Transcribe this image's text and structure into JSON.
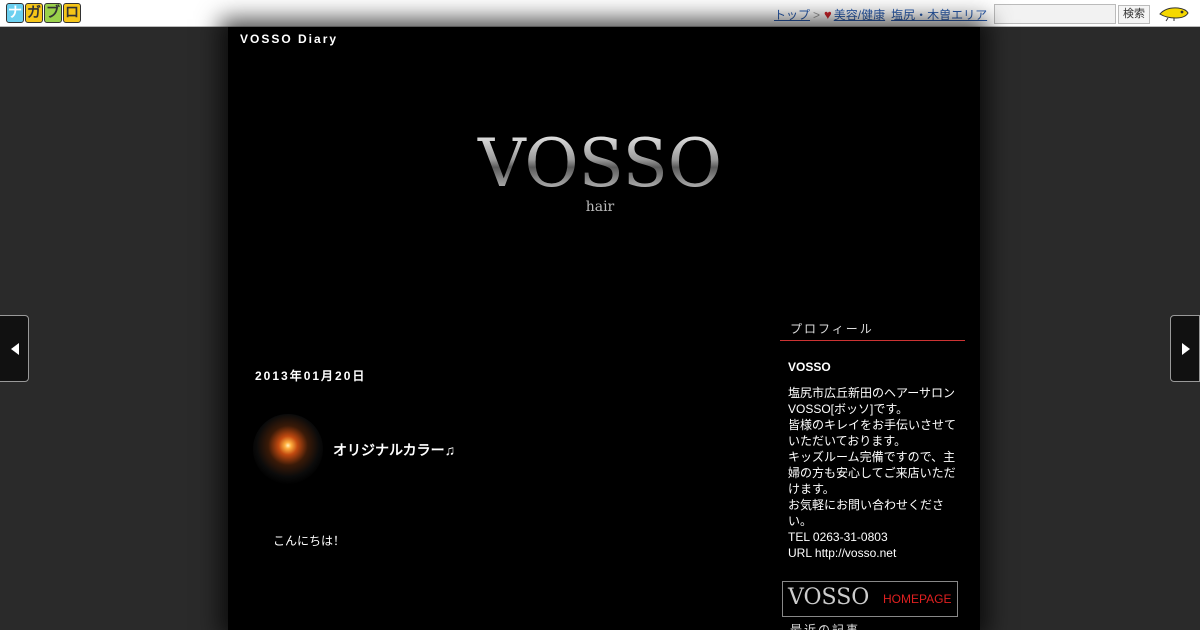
{
  "topbar": {
    "logo_chars": [
      "ナ",
      "ガ",
      "ブ",
      "ロ"
    ],
    "breadcrumb": {
      "top": "トップ",
      "sep": ">",
      "category": "美容/健康",
      "area": "塩尻・木曽エリア"
    },
    "search_placeholder": "",
    "search_button": "検索"
  },
  "blog": {
    "title": "VOSSO Diary",
    "header_logo_main": "VOSSO",
    "header_logo_sub": "hair"
  },
  "post": {
    "date": "2013年01月20日",
    "title": "オリジナルカラー♫",
    "body": "こんにちは！"
  },
  "sidebar": {
    "profile_heading": "プロフィール",
    "profile_name": "VOSSO",
    "profile_lines": [
      "塩尻市広丘新田のヘアーサロンVOSSO[ボッソ]です。",
      "皆様のキレイをお手伝いさせていただいております。",
      "キッズルーム完備ですので、主婦の方も安心してご来店いただけます。",
      "お気軽にお問い合わせください。",
      "TEL 0263-31-0803",
      "URL http://vosso.net"
    ],
    "banner_logo": "VOSSO",
    "banner_link": "HOMEPAGE",
    "recent_heading": "最近の記事"
  },
  "colors": {
    "background": "#2a2a2a",
    "main": "#000000",
    "accent_line": "#cc3333",
    "link": "#2a5db0",
    "banner_link": "#e02020"
  }
}
